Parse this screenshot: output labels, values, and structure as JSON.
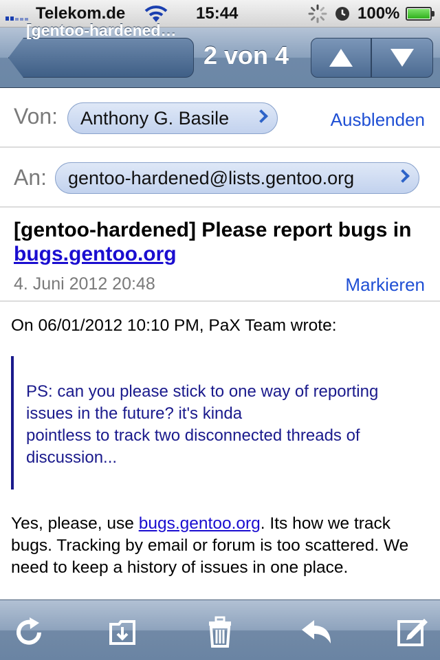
{
  "status_bar": {
    "carrier": "Telekom.de",
    "time": "15:44",
    "battery": "100%",
    "battery_level": 1.0
  },
  "nav": {
    "back_label": "[gentoo-hardened…",
    "counter": "2 von 4"
  },
  "header": {
    "from_label": "Von:",
    "from_name": "Anthony G. Basile",
    "hide_link": "Ausblenden",
    "to_label": "An:",
    "to_address": "gentoo-hardened@lists.gentoo.org"
  },
  "message": {
    "subject_prefix": "[gentoo-hardened] Please report bugs in ",
    "subject_link": "bugs.gentoo.org",
    "date": "4. Juni 2012 20:48",
    "mark_link": "Markieren",
    "intro": "On 06/01/2012 10:10 PM, PaX Team wrote:",
    "quote_lines": [
      "PS: can you please stick to one way of reporting",
      "issues in the future? it's kinda",
      "pointless to track two disconnected threads of",
      "discussion..."
    ],
    "reply_before_link": "Yes, please, use ",
    "reply_link": "bugs.gentoo.org",
    "reply_after_link": ".  Its how we track bugs. Tracking by email or forum is too scattered.  We need to keep a history of issues in one place."
  },
  "colors": {
    "link": "#1a0dd0",
    "action_link": "#1f4fd4",
    "quote": "#1a1a8c",
    "nav_bar": "#6b87a6"
  },
  "toolbar": {
    "icons": [
      "refresh-icon",
      "move-to-folder-icon",
      "trash-icon",
      "reply-icon",
      "compose-icon"
    ]
  }
}
